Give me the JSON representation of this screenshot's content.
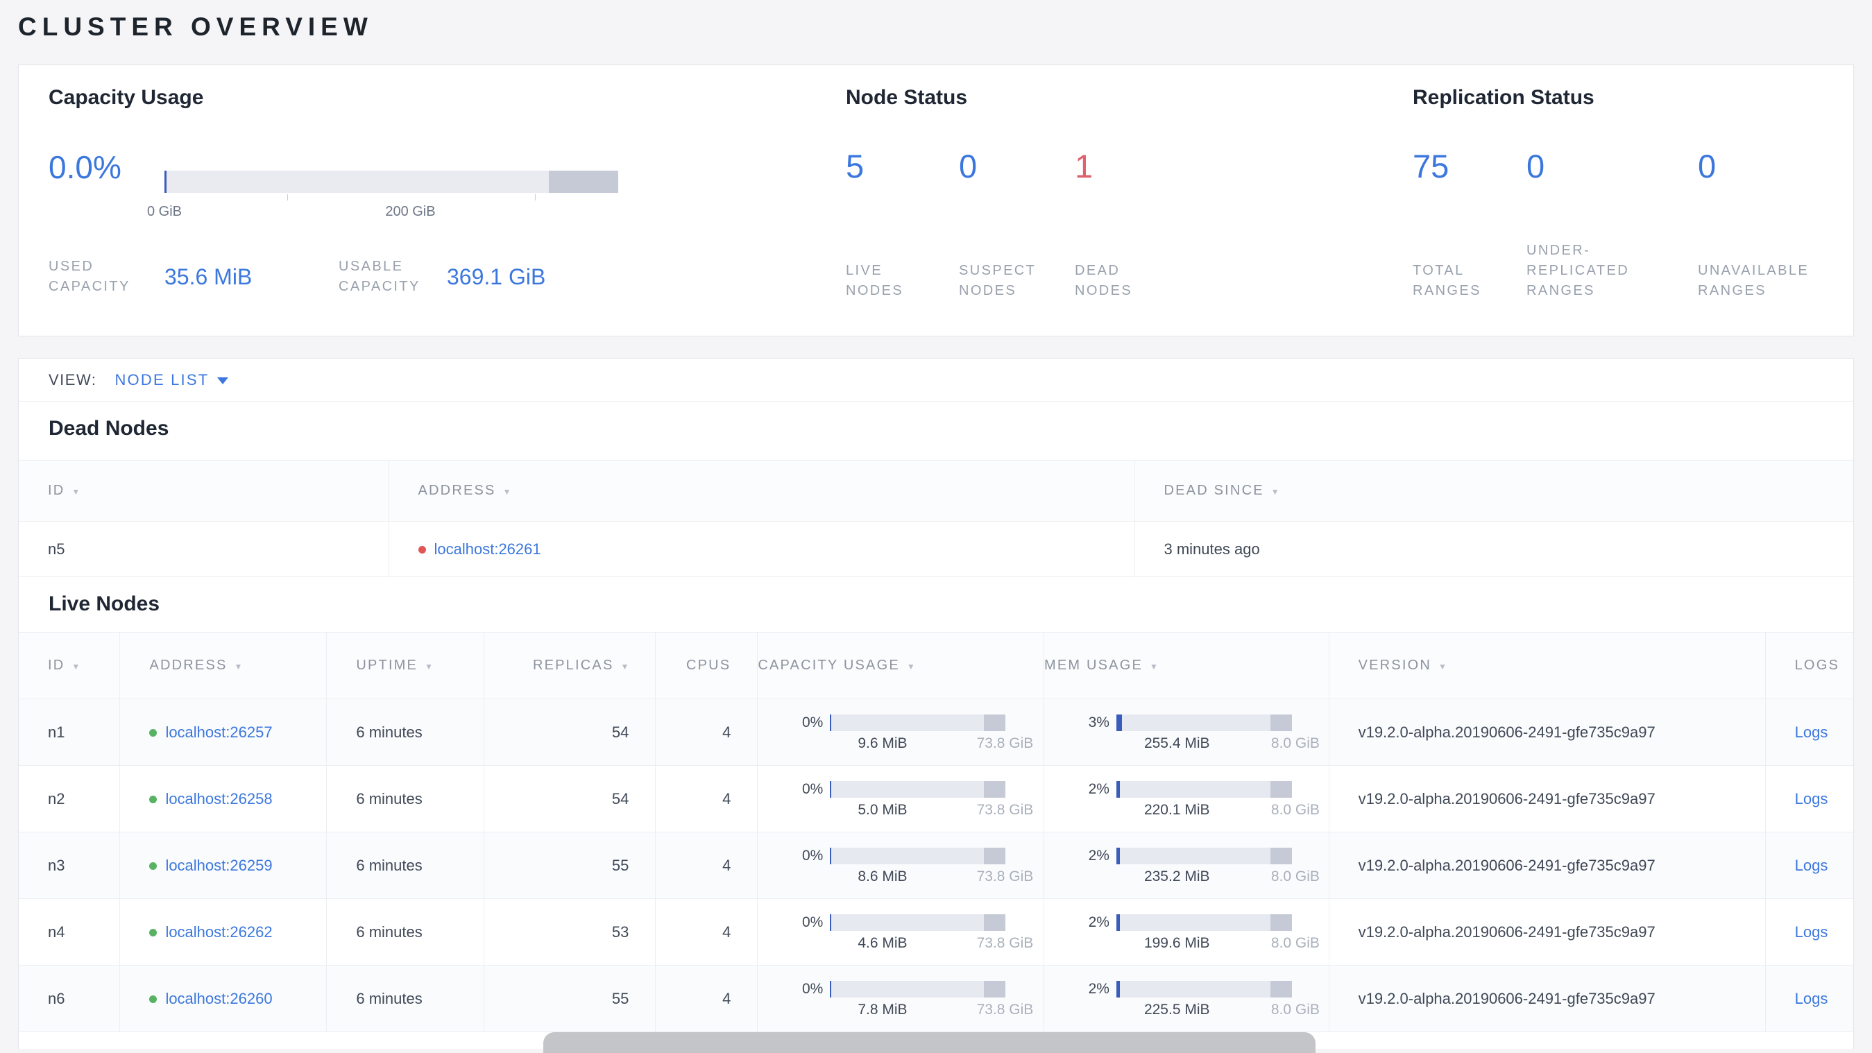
{
  "colors": {
    "accent_blue": "#3b77dd",
    "danger_red": "#e0616e",
    "live_green": "#57b262",
    "dead_dot_red": "#e25555"
  },
  "page_title": "CLUSTER OVERVIEW",
  "summary": {
    "capacity": {
      "title": "Capacity Usage",
      "percent": "0.0%",
      "axis_labels": {
        "zero": "0 GiB",
        "two_hundred": "200 GiB"
      },
      "used_label_lines": [
        "USED",
        "CAPACITY"
      ],
      "used_value": "35.6 MiB",
      "usable_label_lines": [
        "USABLE",
        "CAPACITY"
      ],
      "usable_value": "369.1 GiB"
    },
    "node_status": {
      "title": "Node Status",
      "stats": [
        {
          "value": "5",
          "label_lines": [
            "LIVE",
            "NODES"
          ]
        },
        {
          "value": "0",
          "label_lines": [
            "SUSPECT",
            "NODES"
          ]
        },
        {
          "value": "1",
          "label_lines": [
            "DEAD",
            "NODES"
          ]
        }
      ]
    },
    "replication": {
      "title": "Replication Status",
      "stats": [
        {
          "value": "75",
          "label_lines": [
            "TOTAL",
            "RANGES"
          ]
        },
        {
          "value": "0",
          "label_lines": [
            "UNDER-",
            "REPLICATED",
            "RANGES"
          ]
        },
        {
          "value": "0",
          "label_lines": [
            "UNAVAILABLE",
            "RANGES"
          ]
        }
      ]
    }
  },
  "view_bar": {
    "label": "VIEW:",
    "selected": "NODE LIST"
  },
  "dead_nodes": {
    "title": "Dead Nodes",
    "columns": [
      {
        "key": "id",
        "label": "ID",
        "sortable": true
      },
      {
        "key": "address",
        "label": "ADDRESS",
        "sortable": true
      },
      {
        "key": "dead_since",
        "label": "DEAD SINCE",
        "sortable": true
      }
    ],
    "rows": [
      {
        "id": "n5",
        "address": "localhost:26261",
        "dead_since": "3 minutes ago"
      }
    ]
  },
  "live_nodes": {
    "title": "Live Nodes",
    "columns": [
      {
        "key": "id",
        "label": "ID",
        "sortable": true
      },
      {
        "key": "address",
        "label": "ADDRESS",
        "sortable": true
      },
      {
        "key": "uptime",
        "label": "UPTIME",
        "sortable": true
      },
      {
        "key": "replicas",
        "label": "REPLICAS",
        "sortable": true,
        "align": "right"
      },
      {
        "key": "cpus",
        "label": "CPUS",
        "sortable": false,
        "align": "right"
      },
      {
        "key": "capacity",
        "label": "CAPACITY USAGE",
        "sortable": true
      },
      {
        "key": "mem",
        "label": "MEM USAGE",
        "sortable": true
      },
      {
        "key": "version",
        "label": "VERSION",
        "sortable": true
      },
      {
        "key": "logs",
        "label": "LOGS",
        "sortable": false
      }
    ],
    "rows": [
      {
        "id": "n1",
        "address": "localhost:26257",
        "uptime": "6 minutes",
        "replicas": "54",
        "cpus": "4",
        "capacity": {
          "pct": "0%",
          "pct_num": 0,
          "used": "9.6 MiB",
          "total": "73.8 GiB"
        },
        "mem": {
          "pct": "3%",
          "pct_num": 3,
          "used": "255.4 MiB",
          "total": "8.0 GiB"
        },
        "version": "v19.2.0-alpha.20190606-2491-gfe735c9a97",
        "logs": "Logs"
      },
      {
        "id": "n2",
        "address": "localhost:26258",
        "uptime": "6 minutes",
        "replicas": "54",
        "cpus": "4",
        "capacity": {
          "pct": "0%",
          "pct_num": 0,
          "used": "5.0 MiB",
          "total": "73.8 GiB"
        },
        "mem": {
          "pct": "2%",
          "pct_num": 2,
          "used": "220.1 MiB",
          "total": "8.0 GiB"
        },
        "version": "v19.2.0-alpha.20190606-2491-gfe735c9a97",
        "logs": "Logs"
      },
      {
        "id": "n3",
        "address": "localhost:26259",
        "uptime": "6 minutes",
        "replicas": "55",
        "cpus": "4",
        "capacity": {
          "pct": "0%",
          "pct_num": 0,
          "used": "8.6 MiB",
          "total": "73.8 GiB"
        },
        "mem": {
          "pct": "2%",
          "pct_num": 2,
          "used": "235.2 MiB",
          "total": "8.0 GiB"
        },
        "version": "v19.2.0-alpha.20190606-2491-gfe735c9a97",
        "logs": "Logs"
      },
      {
        "id": "n4",
        "address": "localhost:26262",
        "uptime": "6 minutes",
        "replicas": "53",
        "cpus": "4",
        "capacity": {
          "pct": "0%",
          "pct_num": 0,
          "used": "4.6 MiB",
          "total": "73.8 GiB"
        },
        "mem": {
          "pct": "2%",
          "pct_num": 2,
          "used": "199.6 MiB",
          "total": "8.0 GiB"
        },
        "version": "v19.2.0-alpha.20190606-2491-gfe735c9a97",
        "logs": "Logs"
      },
      {
        "id": "n6",
        "address": "localhost:26260",
        "uptime": "6 minutes",
        "replicas": "55",
        "cpus": "4",
        "capacity": {
          "pct": "0%",
          "pct_num": 0,
          "used": "7.8 MiB",
          "total": "73.8 GiB"
        },
        "mem": {
          "pct": "2%",
          "pct_num": 2,
          "used": "225.5 MiB",
          "total": "8.0 GiB"
        },
        "version": "v19.2.0-alpha.20190606-2491-gfe735c9a97",
        "logs": "Logs"
      }
    ]
  }
}
